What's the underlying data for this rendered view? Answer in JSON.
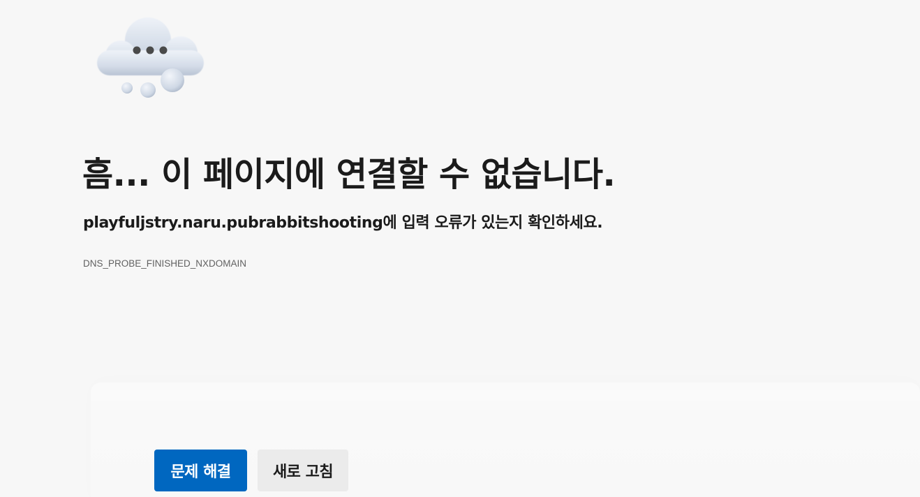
{
  "illustration": {
    "icon": "thinking-cloud-icon"
  },
  "error": {
    "headline": "흠... 이 페이지에 연결할 수 없습니다.",
    "detail": "playfuljstry.naru.pubrabbitshooting에 입력 오류가 있는지 확인하세요.",
    "code": "DNS_PROBE_FINISHED_NXDOMAIN"
  },
  "actions": {
    "troubleshoot_label": "문제 해결",
    "refresh_label": "새로 고침"
  },
  "colors": {
    "background": "#f7f7f7",
    "primary_button": "#0067c0",
    "secondary_button": "#ebebeb",
    "text": "#1b1b1b",
    "muted_text": "#616161"
  }
}
